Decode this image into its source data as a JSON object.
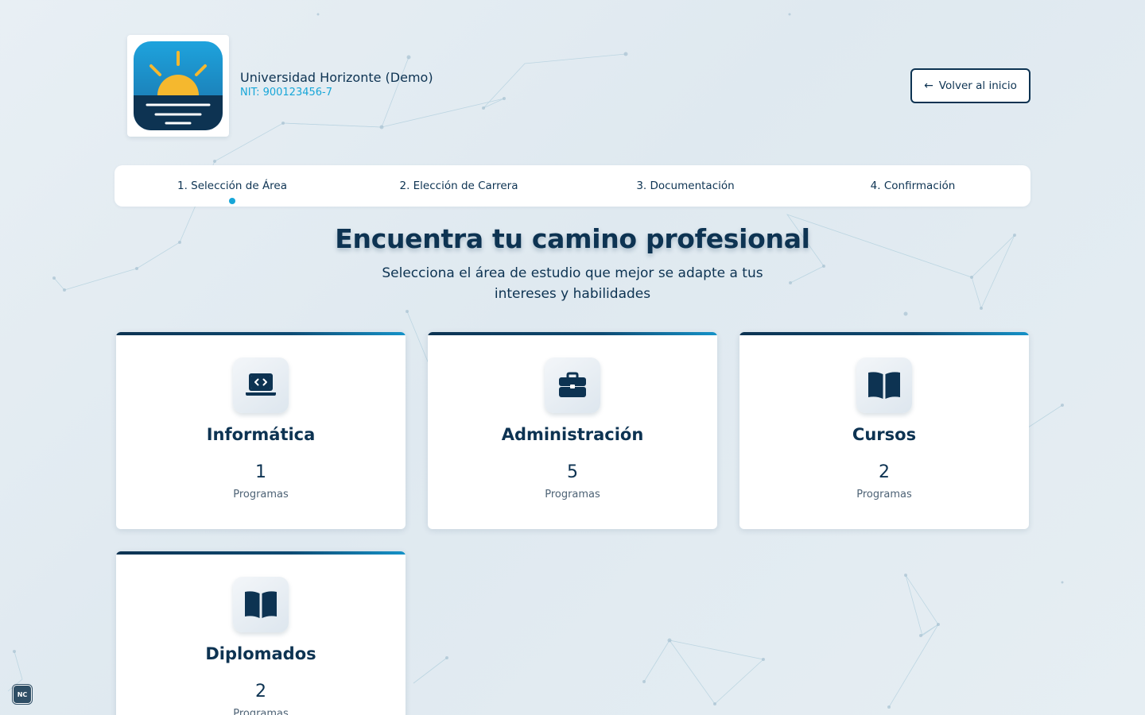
{
  "header": {
    "org_name": "Universidad Horizonte (Demo)",
    "org_nit": "NIT: 900123456-7",
    "back_label": "Volver al inicio",
    "logo_icon": "sunrise-logo"
  },
  "steps": [
    {
      "label": "1. Selección de Área",
      "active": true
    },
    {
      "label": "2. Elección de Carrera",
      "active": false
    },
    {
      "label": "3. Documentación",
      "active": false
    },
    {
      "label": "4. Confirmación",
      "active": false
    }
  ],
  "hero": {
    "title": "Encuentra tu camino profesional",
    "subtitle": "Selecciona el área de estudio que mejor se adapte a tus intereses y habilidades"
  },
  "areas": [
    {
      "title": "Informática",
      "count": "1",
      "unit": "Programas",
      "icon": "laptop-code-icon"
    },
    {
      "title": "Administración",
      "count": "5",
      "unit": "Programas",
      "icon": "briefcase-icon"
    },
    {
      "title": "Cursos",
      "count": "2",
      "unit": "Programas",
      "icon": "open-book-icon"
    },
    {
      "title": "Diplomados",
      "count": "2",
      "unit": "Programas",
      "icon": "open-book-icon"
    }
  ],
  "badge": {
    "label": "NC"
  },
  "colors": {
    "primary": "#0d3352",
    "accent": "#17a6d8",
    "background": "#e4edf3"
  }
}
